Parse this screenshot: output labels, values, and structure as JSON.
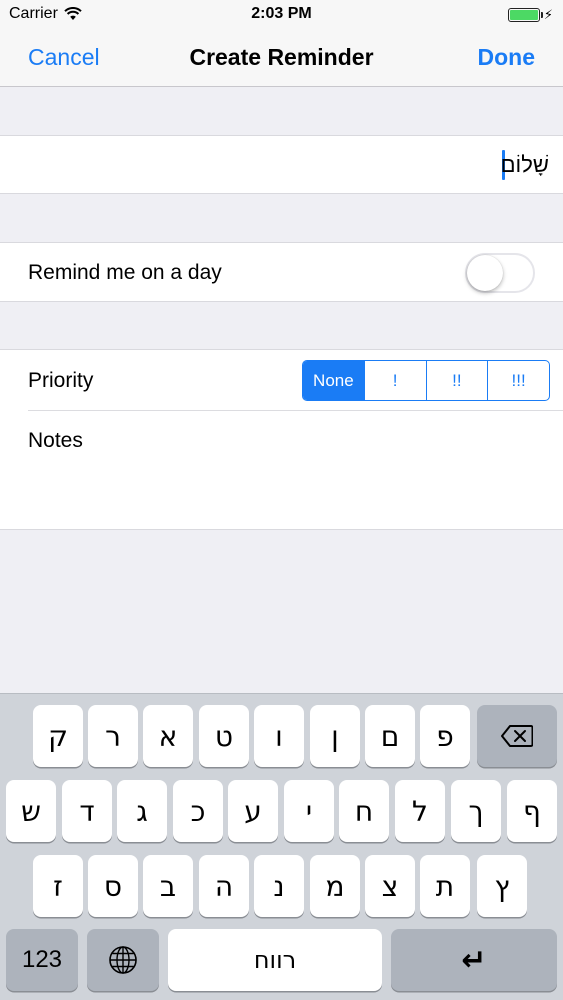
{
  "status_bar": {
    "carrier": "Carrier",
    "time": "2:03 PM",
    "battery_color": "#4cd964",
    "icons": [
      "wifi-icon",
      "battery-icon",
      "charging-bolt-icon"
    ]
  },
  "nav": {
    "cancel_label": "Cancel",
    "title": "Create Reminder",
    "done_label": "Done",
    "accent_color": "#1a7cf5"
  },
  "reminder": {
    "title_value": "שָׁלוֹם",
    "remind_label": "Remind me on a day",
    "remind_on": false,
    "priority_label": "Priority",
    "priority_options": [
      "None",
      "!",
      "!!",
      "!!!"
    ],
    "priority_selected": "None",
    "notes_label": "Notes"
  },
  "keyboard": {
    "row1": [
      "ק",
      "ר",
      "א",
      "ט",
      "ו",
      "ן",
      "ם",
      "פ"
    ],
    "row2": [
      "ש",
      "ד",
      "ג",
      "כ",
      "ע",
      "י",
      "ח",
      "ל",
      "ך",
      "ף"
    ],
    "row3": [
      "ז",
      "ס",
      "ב",
      "ה",
      "נ",
      "מ",
      "צ",
      "ת",
      "ץ"
    ],
    "numbers_label": "123",
    "space_label": "רווח",
    "return_label": "↵",
    "icons": [
      "backspace-icon",
      "globe-icon",
      "return-icon"
    ]
  }
}
